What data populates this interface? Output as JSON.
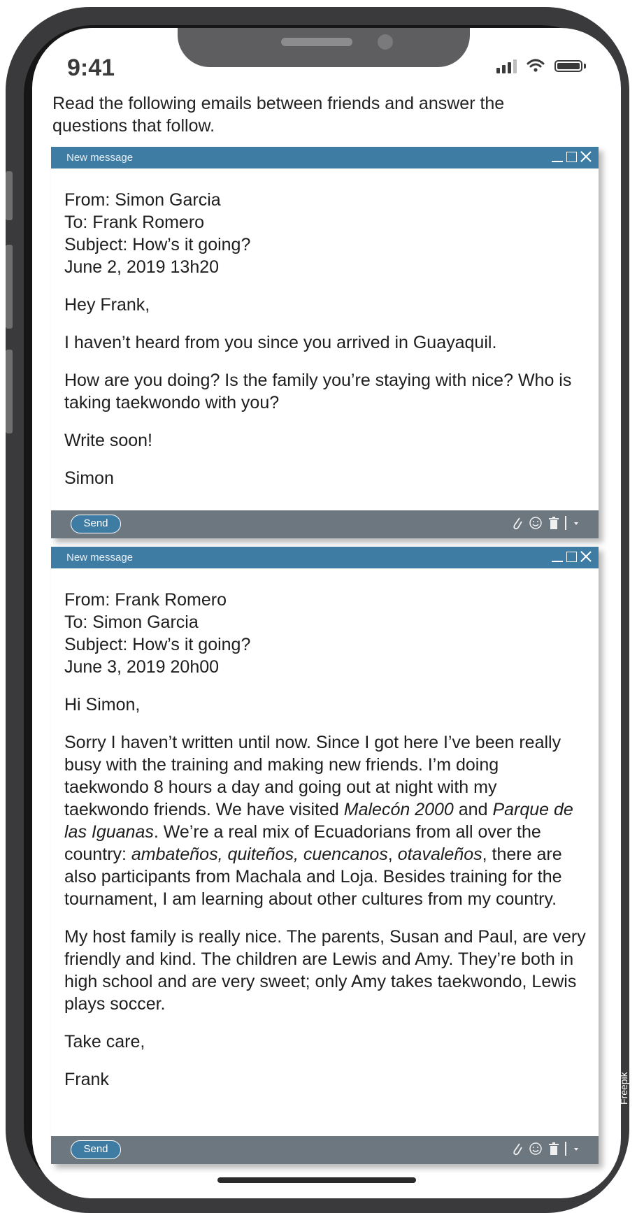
{
  "status_bar": {
    "time": "9:41"
  },
  "instructions": "Read the following emails between friends and answer the questions that follow.",
  "emails": [
    {
      "window_title": "New message",
      "from": "From: Simon Garcia",
      "to": "To: Frank Romero",
      "subject": "Subject: How’s it going?",
      "date": "June 2, 2019 13h20",
      "greeting": "Hey Frank,",
      "paragraphs": [
        "I haven’t heard from you since you arrived in Guayaquil.",
        "How are you doing? Is the family you’re staying with nice? Who is taking taekwondo with you?"
      ],
      "closing": "Write soon!",
      "signature": "Simon",
      "send_label": "Send"
    },
    {
      "window_title": "New message",
      "from": "From: Frank Romero",
      "to": "To: Simon Garcia",
      "subject": "Subject: How’s it going?",
      "date": "June 3, 2019 20h00",
      "greeting": "Hi Simon,",
      "p1": {
        "a": "Sorry I haven’t written until now. Since I got here I’ve been really busy with the training and making new friends. I’m doing taekwondo 8 hours a day and going out at night with my taekwondo friends. We have visited ",
        "i1": "Malecón 2000",
        "b": " and ",
        "i2": "Parque de las Iguanas",
        "c": ". We’re a real mix of Ecuadorians from all over the country: ",
        "i3": "ambateños, quiteños, cuencanos",
        "d": ", ",
        "i4": "otavaleños",
        "e": ", there are also participants from Machala and Loja. Besides training for the tournament, I am learning about other cultures from my country."
      },
      "p2": "My host family is really nice. The parents, Susan and Paul, are very friendly and kind. The children are Lewis and Amy. They’re both in high school and are very sweet; only Amy takes taekwondo, Lewis plays soccer.",
      "closing": "Take care,",
      "signature": "Frank",
      "send_label": "Send"
    }
  ],
  "credit": "Freepik",
  "colors": {
    "header_blue": "#3e7ca4",
    "footer_gray": "#6d7780",
    "frame": "#3a3a3c"
  },
  "icons": [
    "attachment-icon",
    "emoji-icon",
    "trash-icon",
    "dropdown-caret-icon",
    "minimize-icon",
    "maximize-icon",
    "close-icon",
    "signal-icon",
    "wifi-icon",
    "battery-icon"
  ]
}
